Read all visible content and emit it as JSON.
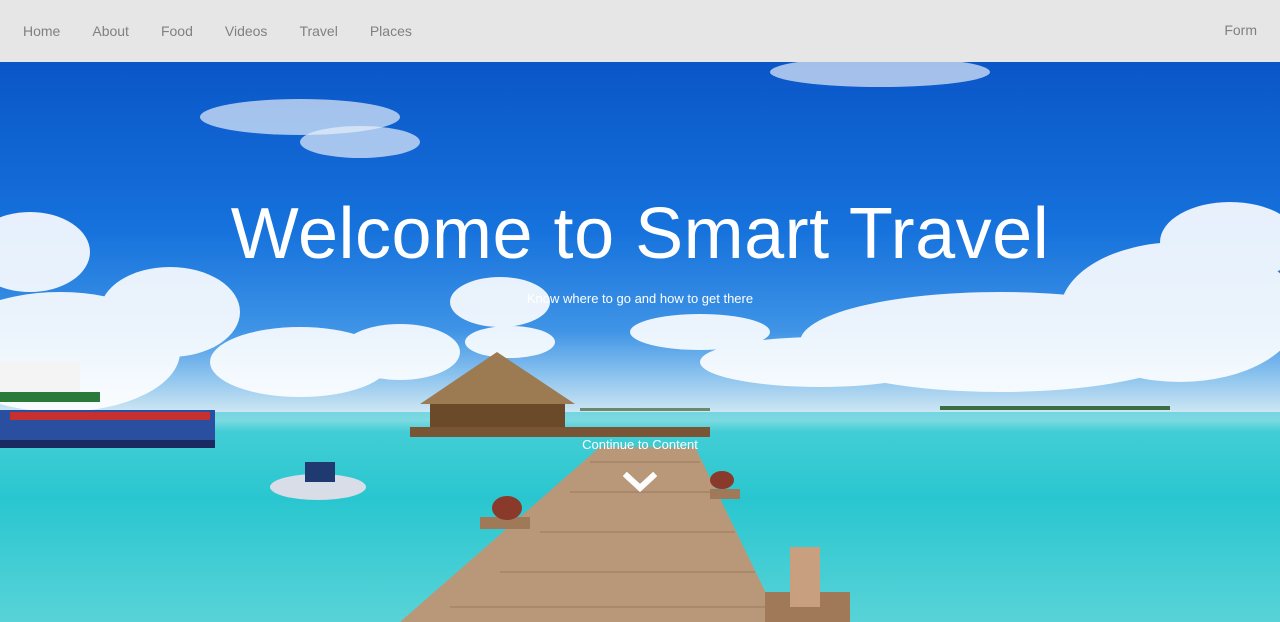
{
  "nav": {
    "items": [
      {
        "label": "Home"
      },
      {
        "label": "About"
      },
      {
        "label": "Food"
      },
      {
        "label": "Videos"
      },
      {
        "label": "Travel"
      },
      {
        "label": "Places"
      }
    ],
    "right_item": {
      "label": "Form"
    }
  },
  "hero": {
    "title": "Welcome to Smart Travel",
    "subtitle": "Know where to go and how to get there",
    "continue_label": "Continue to Content",
    "continue_icon": "chevron-down-icon"
  },
  "colors": {
    "navbar_bg": "#e6e6e6",
    "nav_text": "#808080",
    "hero_text": "#ffffff",
    "sky": "#1672dc",
    "water": "#27c6d0"
  }
}
